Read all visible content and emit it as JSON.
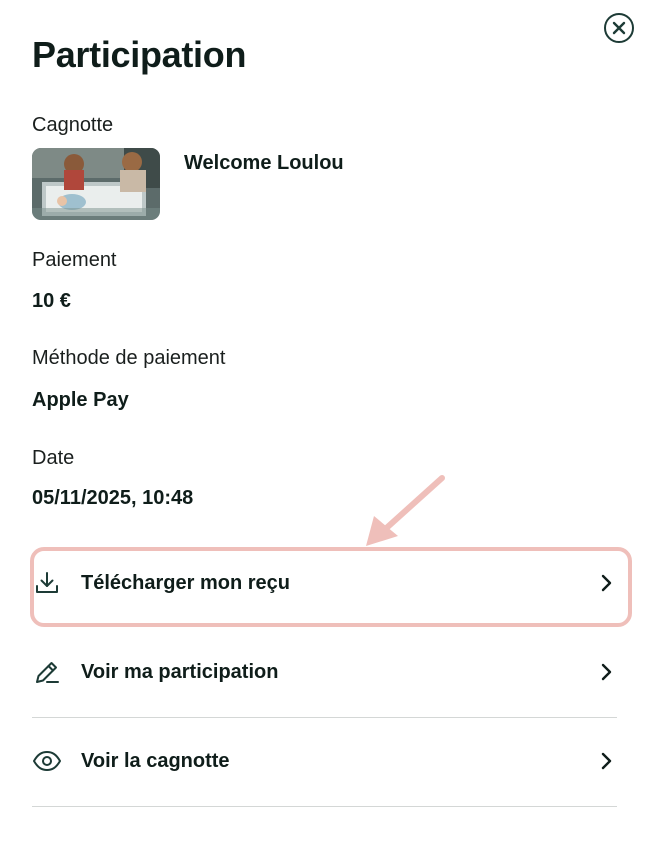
{
  "header": {
    "title": "Participation",
    "close_icon": "close-circle-icon"
  },
  "details": {
    "cagnotte_label": "Cagnotte",
    "cagnotte_name": "Welcome Loulou",
    "paiement_label": "Paiement",
    "paiement_value": "10 €",
    "methode_label": "Méthode de paiement",
    "methode_value": "Apple Pay",
    "date_label": "Date",
    "date_value": "05/11/2025, 10:48"
  },
  "actions": [
    {
      "label": "Télécharger mon reçu",
      "icon": "download-icon"
    },
    {
      "label": "Voir ma participation",
      "icon": "pencil-icon"
    },
    {
      "label": "Voir la cagnotte",
      "icon": "eye-icon"
    }
  ],
  "colors": {
    "text": "#0f1d1a",
    "icon": "#1d3b36",
    "divider": "#d4d7d6",
    "annotation": "#efbfba"
  }
}
